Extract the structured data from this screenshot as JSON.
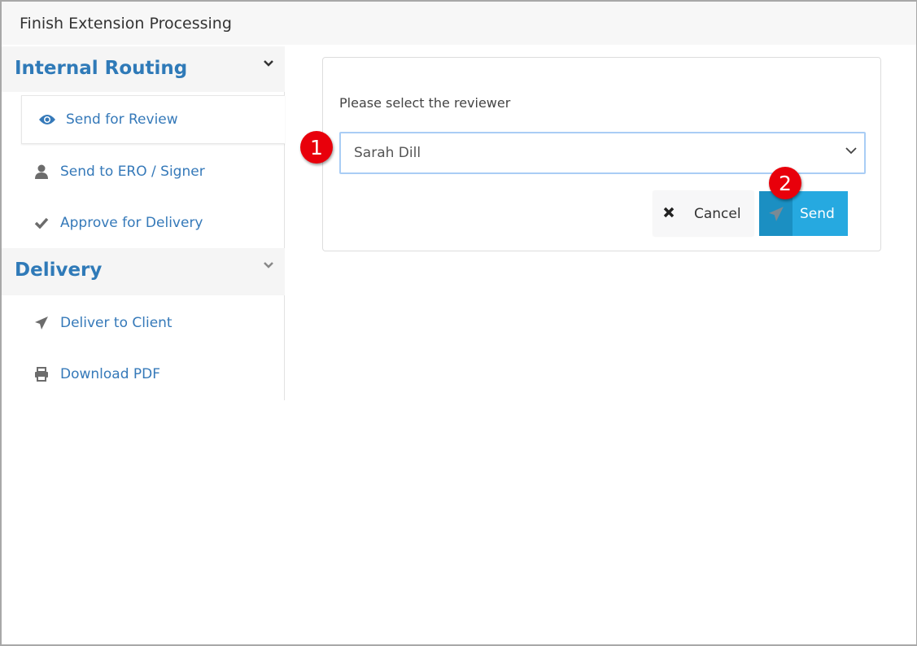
{
  "window": {
    "title": "Finish Extension Processing"
  },
  "sidebar": {
    "groups": [
      {
        "label": "Internal Routing",
        "icon": "chevron-down-icon",
        "items": [
          {
            "label": "Send for Review",
            "icon": "eye-icon",
            "active": true
          },
          {
            "label": "Send to ERO / Signer",
            "icon": "user-icon"
          },
          {
            "label": "Approve for Delivery",
            "icon": "check-icon"
          }
        ]
      },
      {
        "label": "Delivery",
        "icon": "chevron-down-icon",
        "items": [
          {
            "label": "Deliver to Client",
            "icon": "paper-plane-icon"
          },
          {
            "label": "Download PDF",
            "icon": "printer-icon"
          }
        ]
      }
    ]
  },
  "form": {
    "label": "Please select the reviewer",
    "reviewer_selected": "Sarah Dill",
    "cancel_label": "Cancel",
    "send_label": "Send"
  },
  "annotations": [
    "1",
    "2"
  ],
  "colors": {
    "accent": "#2f7ab8",
    "send": "#26a9e0",
    "badge": "#e8000b"
  }
}
